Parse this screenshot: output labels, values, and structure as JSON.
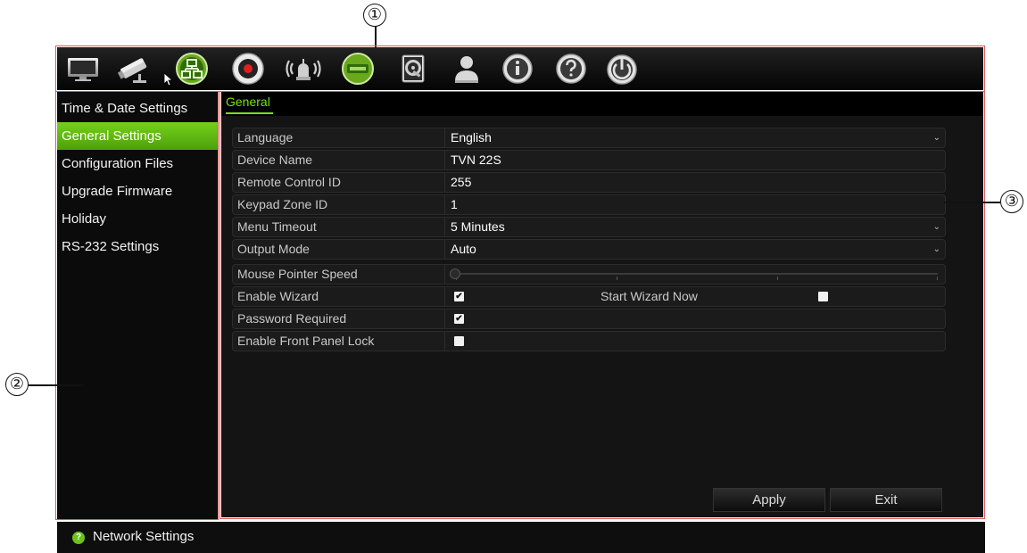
{
  "callouts": {
    "one": "①",
    "two": "②",
    "three": "③"
  },
  "toolbar": {
    "icons": [
      "display-icon",
      "camera-icon",
      "network-icon",
      "record-icon",
      "alarm-icon",
      "hdd-icon",
      "storage-icon",
      "user-icon",
      "info-icon",
      "help-icon",
      "power-icon"
    ],
    "active_icon": "network-icon"
  },
  "sidebar": {
    "items": [
      {
        "label": "Time & Date Settings"
      },
      {
        "label": "General Settings",
        "active": true
      },
      {
        "label": "Configuration Files"
      },
      {
        "label": "Upgrade Firmware"
      },
      {
        "label": "Holiday"
      },
      {
        "label": "RS-232 Settings"
      }
    ]
  },
  "main": {
    "tab": "General",
    "rows": [
      {
        "label": "Language",
        "value": "English"
      },
      {
        "label": "Device Name",
        "value": "TVN 22S"
      },
      {
        "label": "Remote Control ID",
        "value": "255"
      },
      {
        "label": "Keypad Zone ID",
        "value": "1"
      },
      {
        "label": "Menu Timeout",
        "value": "5 Minutes"
      },
      {
        "label": "Output Mode",
        "value": "Auto"
      },
      {
        "label": "Mouse Pointer Speed",
        "value": ""
      },
      {
        "label": "Enable Wizard",
        "checked": true,
        "label2": "Start Wizard Now",
        "checked2": false
      },
      {
        "label": "Password Required",
        "checked": true
      },
      {
        "label": "Enable Front Panel Lock",
        "checked": false
      }
    ],
    "mouse_pointer_speed_level": 0,
    "apply_label": "Apply",
    "exit_label": "Exit"
  },
  "statusbar": {
    "text": "Network Settings"
  },
  "colors": {
    "accent": "#6cc21a",
    "frame": "#e05a5a"
  }
}
